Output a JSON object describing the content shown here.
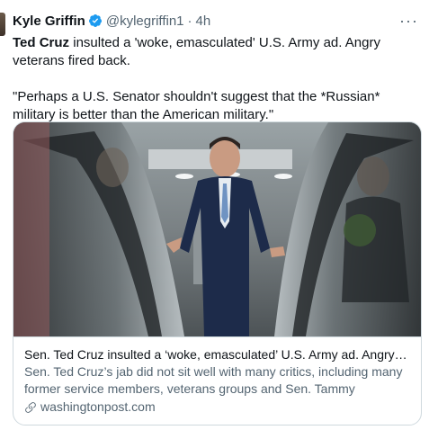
{
  "tweet": {
    "author_name": "Kyle Griffin",
    "handle": "@kylegriffin1",
    "separator": "·",
    "time": "4h",
    "more_label": "···",
    "text_bold": "Ted Cruz",
    "text_rest": " insulted a 'woke, emasculated' U.S. Army ad. Angry veterans fired back.",
    "quote": "\"Perhaps a U.S. Senator shouldn't suggest that the *Russian* military is better than the American military.\""
  },
  "card": {
    "title": "Sen. Ted Cruz insulted a ‘woke, emasculated’ U.S. Army ad. Angry veter...",
    "description": "Sen. Ted Cruz’s jab did not sit well with many critics, including many former service members, veterans groups and Sen. Tammy Duckworth, ...",
    "domain": "washingtonpost.com"
  },
  "icons": {
    "verified": "verified-badge-icon",
    "more": "more-options-icon",
    "link": "link-icon"
  },
  "colors": {
    "text_primary": "#0f1419",
    "text_secondary": "#536471",
    "verified_blue": "#1d9bf0",
    "border": "#cfd9de"
  }
}
